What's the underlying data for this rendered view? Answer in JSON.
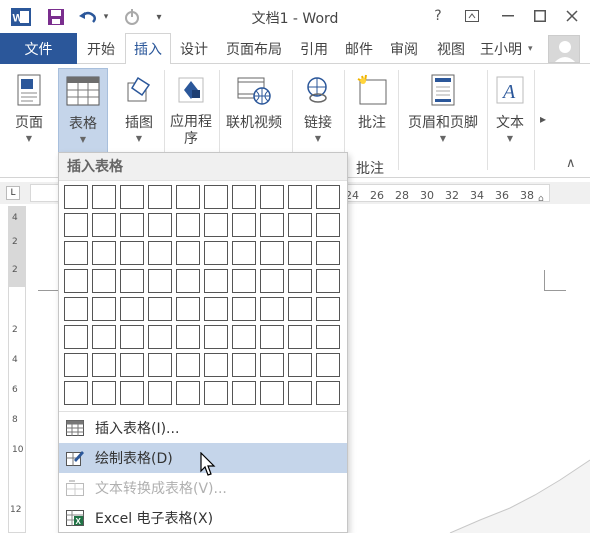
{
  "window": {
    "title": "文档1 - Word",
    "help": "?",
    "ribbon_display": "⊼",
    "minimize": "—",
    "maximize": "☐",
    "close": "✕"
  },
  "qat": {
    "app_icon": "word-icon",
    "save_icon": "save-icon",
    "undo_icon": "undo-icon",
    "undo_more": "▾",
    "redo_icon": "redo-icon",
    "customize": "▾"
  },
  "tabs": {
    "file": "文件",
    "items": [
      "开始",
      "插入",
      "设计",
      "页面布局",
      "引用",
      "邮件",
      "审阅",
      "视图"
    ],
    "active": "插入",
    "user": "王小明",
    "user_caret": "▾"
  },
  "ribbon": {
    "buttons": {
      "page": "页面",
      "table": "表格",
      "illustrations": "插图",
      "apps": "应用程序",
      "online_video": "联机视频",
      "links": "链接",
      "comment": "批注",
      "header_footer": "页眉和页脚",
      "text": "文本"
    },
    "group_labels": {
      "comment": "批注"
    },
    "scroll_right": "▸",
    "collapse": "∧"
  },
  "ruler": {
    "corner": "L",
    "numbers": [
      "24",
      "26",
      "28",
      "30",
      "32",
      "34",
      "36",
      "38"
    ],
    "left_marker": "2",
    "vertical_numbers": [
      "4",
      "2",
      "2",
      "2",
      "4",
      "6",
      "8",
      "10",
      "12"
    ]
  },
  "dropdown": {
    "header": "插入表格",
    "grid_cols": 10,
    "grid_rows": 8,
    "items": [
      {
        "label": "插入表格(I)...",
        "icon": "insert-table-icon",
        "state": "normal"
      },
      {
        "label": "绘制表格(D)",
        "icon": "draw-table-icon",
        "state": "hover"
      },
      {
        "label": "文本转换成表格(V)...",
        "icon": "text-to-table-icon",
        "state": "disabled"
      },
      {
        "label": "Excel 电子表格(X)",
        "icon": "excel-icon",
        "state": "normal"
      }
    ]
  },
  "colors": {
    "brand_blue": "#2b579a",
    "pressed": "#c5d5ea",
    "excel_green": "#217346"
  }
}
